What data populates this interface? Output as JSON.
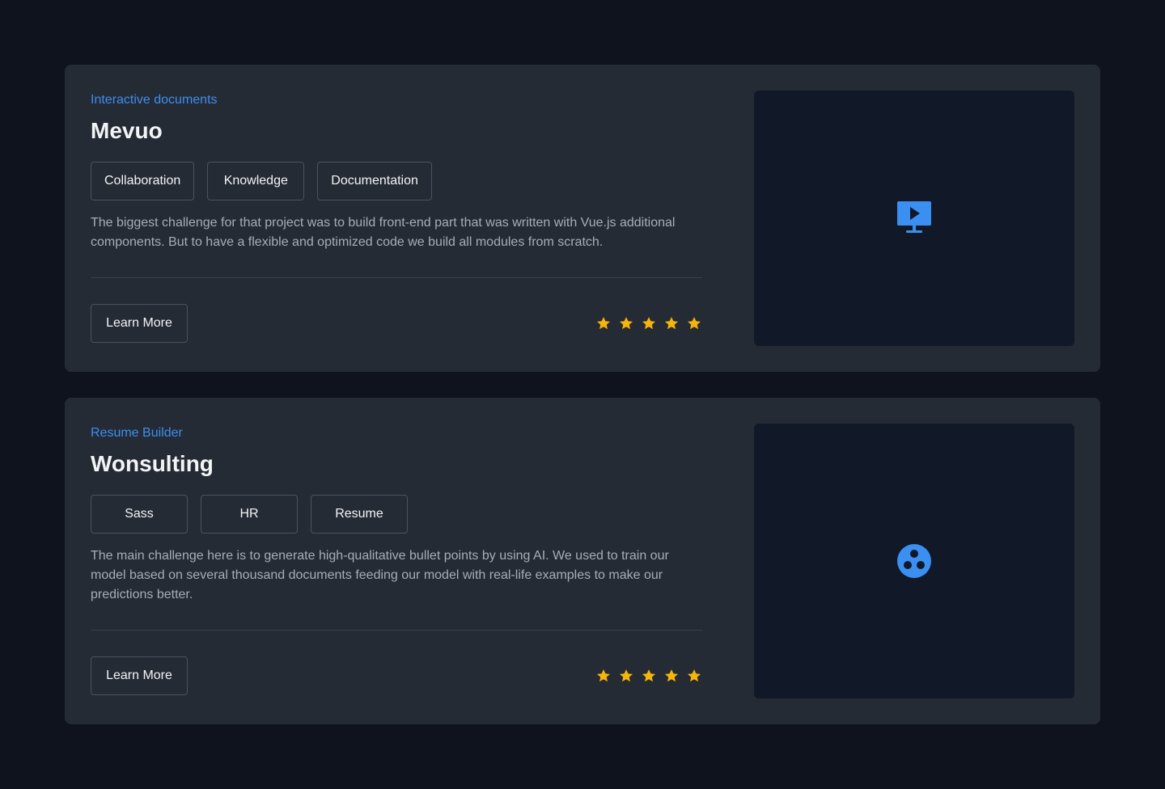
{
  "colors": {
    "background": "#0e131e",
    "card": "#252b34",
    "media": "#111827",
    "accent": "#3b8ff0",
    "star": "#f5b50a"
  },
  "projects": [
    {
      "category": "Interactive documents",
      "title": "Mevuo",
      "tags": [
        "Collaboration",
        "Knowledge",
        "Documentation"
      ],
      "description": "The biggest challenge for that project was to build front-end part that was written with Vue.js additional components. But to have a flexible and optimized code we build all modules from scratch.",
      "button_label": "Learn More",
      "rating": 5,
      "rating_max": 5,
      "media_icon": "presentation-play-icon"
    },
    {
      "category": "Resume Builder",
      "title": "Wonsulting",
      "tags": [
        "Sass",
        "HR",
        "Resume"
      ],
      "description": "The main challenge here is to generate high-qualitative bullet points by using AI. We used to train our model based on several thousand documents feeding our model with real-life examples to make our predictions better.",
      "button_label": "Learn More",
      "rating": 5,
      "rating_max": 5,
      "media_icon": "film-reel-icon"
    }
  ]
}
